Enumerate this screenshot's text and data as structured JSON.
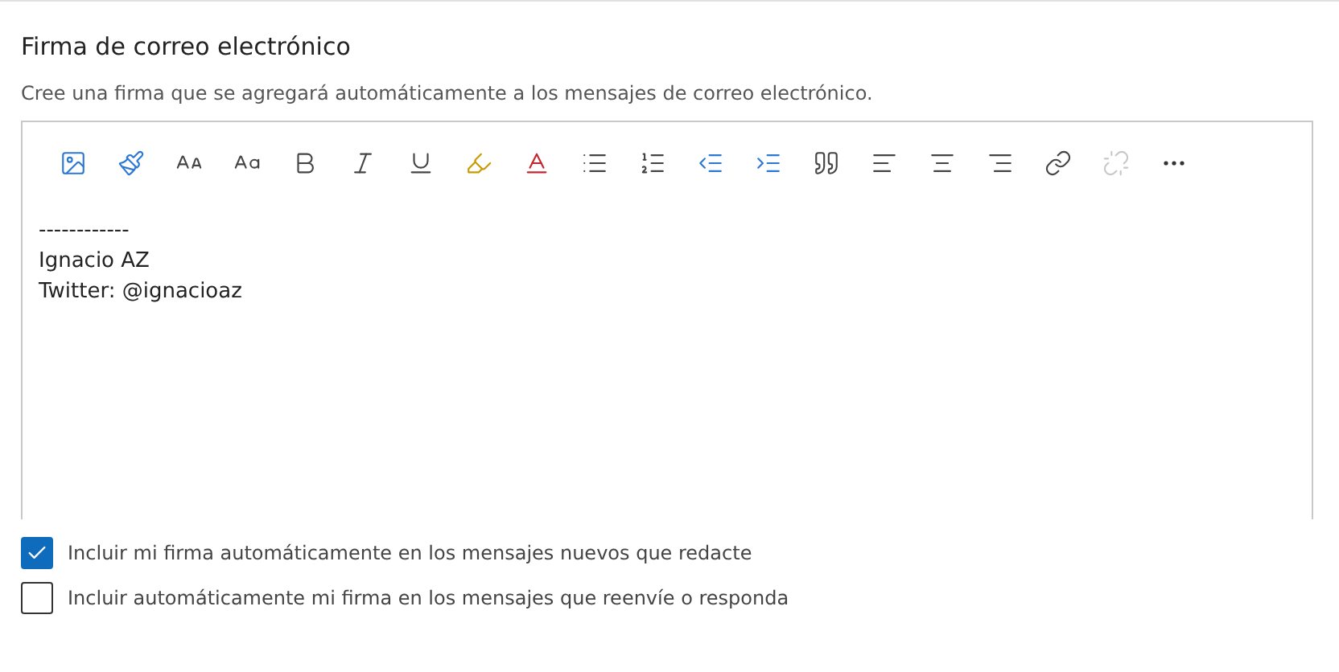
{
  "title": "Firma de correo electrónico",
  "description": "Cree una firma que se agregará automáticamente a los mensajes de correo electrónico.",
  "toolbar": [
    {
      "kind": "image",
      "disabled": false
    },
    {
      "kind": "painter",
      "disabled": false
    },
    {
      "kind": "fontsize",
      "disabled": false
    },
    {
      "kind": "grow",
      "disabled": false
    },
    {
      "kind": "bold",
      "disabled": false
    },
    {
      "kind": "italic",
      "disabled": false
    },
    {
      "kind": "underline",
      "disabled": false
    },
    {
      "kind": "highlight",
      "disabled": false
    },
    {
      "kind": "fontcolor",
      "disabled": false
    },
    {
      "kind": "bullets",
      "disabled": false
    },
    {
      "kind": "numbers",
      "disabled": false
    },
    {
      "kind": "outdent",
      "disabled": false
    },
    {
      "kind": "indent",
      "disabled": false
    },
    {
      "kind": "quote",
      "disabled": false
    },
    {
      "kind": "alignleft",
      "disabled": false
    },
    {
      "kind": "aligncenter",
      "disabled": false
    },
    {
      "kind": "alignright",
      "disabled": false
    },
    {
      "kind": "link",
      "disabled": false
    },
    {
      "kind": "unlink",
      "disabled": true
    },
    {
      "kind": "more",
      "disabled": false
    }
  ],
  "signature_lines": [
    "------------",
    "Ignacio AZ",
    "Twitter: @ignacioaz"
  ],
  "options": [
    {
      "label": "Incluir mi firma automáticamente en los mensajes nuevos que redacte",
      "checked": true
    },
    {
      "label": "Incluir automáticamente mi firma en los mensajes que reenvíe o responda",
      "checked": false
    }
  ]
}
